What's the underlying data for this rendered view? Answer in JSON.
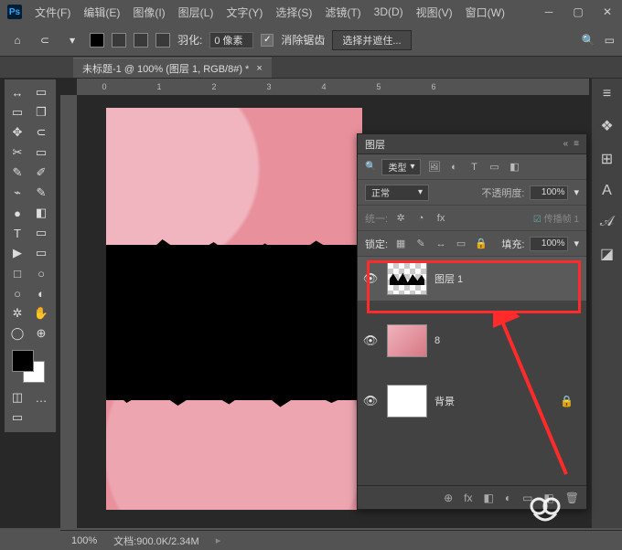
{
  "app": {
    "short": "Ps"
  },
  "menu": [
    "文件(F)",
    "编辑(E)",
    "图像(I)",
    "图层(L)",
    "文字(Y)",
    "选择(S)",
    "滤镜(T)",
    "3D(D)",
    "视图(V)",
    "窗口(W)"
  ],
  "options": {
    "feather_label": "羽化:",
    "feather_value": "0 像素",
    "antialias": "消除锯齿",
    "antialias_checked": "✓",
    "select_mode": "选择并遮住...",
    "home": "⌂",
    "lasso": "⊂",
    "chev": "▾"
  },
  "doctab": {
    "title": "未标题-1 @ 100% (图层 1, RGB/8#) *",
    "close": "×"
  },
  "ruler": [
    "0",
    "1",
    "2",
    "3",
    "4",
    "5",
    "6"
  ],
  "tools_left": [
    "↔",
    "▭",
    "✥",
    "✂",
    "✎",
    "⌁",
    "●",
    "T",
    "▶",
    "□",
    "○",
    "✲",
    "◯"
  ],
  "tools_right": [
    "▭",
    "❐",
    "⊂",
    "▭",
    "✐",
    "✎",
    "◧",
    "▭",
    "▭",
    "○",
    "◐",
    "✋",
    "⊕"
  ],
  "tool_extras": [
    "◫",
    "…",
    "▭"
  ],
  "rightIcons": [
    "≡",
    "❖",
    "⊞",
    "A",
    "𝒜",
    "◪"
  ],
  "layersPanel": {
    "tab": "图层",
    "tabSpacerL": "«",
    "tabSpacerR": "≡",
    "filter_label": "类型",
    "filter_icons": [
      "🖼",
      "◐",
      "T",
      "▭",
      "◧"
    ],
    "blend": "正常",
    "opacity_label": "不透明度:",
    "opacity_value": "100%",
    "unify_label": "统一:",
    "unify_icons": [
      "✲",
      "◔",
      "fx"
    ],
    "propagate": "传播帧 1",
    "lock_label": "锁定:",
    "lock_icons": [
      "▦",
      "✎",
      "↔",
      "▭",
      "🔒"
    ],
    "fill_label": "填充:",
    "fill_value": "100%",
    "eye": "👁",
    "layers": [
      {
        "name": "图层 1",
        "thumb": "trans",
        "active": true
      },
      {
        "name": "8",
        "thumb": "pet"
      },
      {
        "name": "背景",
        "thumb": "white",
        "locked": true
      }
    ],
    "footer": [
      "⊕",
      "fx",
      "◧",
      "◐",
      "▭",
      "◧",
      "🗑"
    ],
    "lockGlyph": "🔒"
  },
  "status": {
    "zoom": "100%",
    "docsize_label": "文档:",
    "docsize": "900.0K/2.34M"
  }
}
